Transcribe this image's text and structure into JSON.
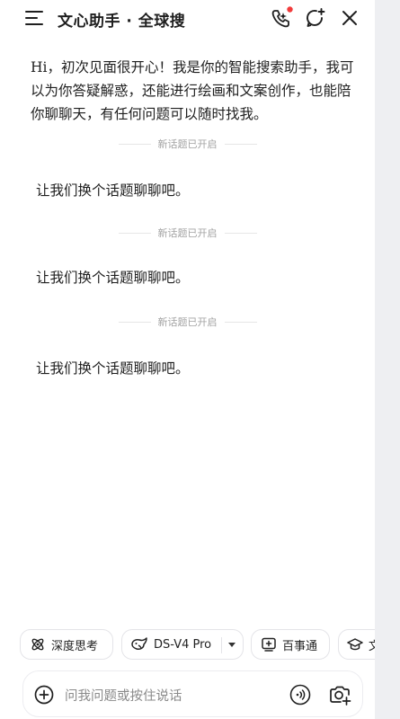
{
  "header": {
    "title": "文心助手 · 全球搜",
    "icons": [
      "menu-icon",
      "phone-call-icon",
      "new-chat-icon",
      "close-icon"
    ],
    "notification_dot_color": "#f23b3b"
  },
  "conversation": {
    "greeting": "Hi，初次见面很开心！我是你的智能搜索助手，我可以为你答疑解惑，还能进行绘画和文案创作，也能陪你聊聊天，有任何问题可以随时找我。",
    "sections": [
      {
        "divider": "新话题已开启",
        "message": "让我们换个话题聊聊吧。"
      },
      {
        "divider": "新话题已开启",
        "message": "让我们换个话题聊聊吧。"
      },
      {
        "divider": "新话题已开启",
        "message": "让我们换个话题聊聊吧。"
      }
    ]
  },
  "chips": {
    "deep_think": "深度思考",
    "model": "DS-V4 Pro",
    "baishitong": "百事通",
    "more": "文"
  },
  "input": {
    "placeholder": "问我问题或按住说话"
  }
}
